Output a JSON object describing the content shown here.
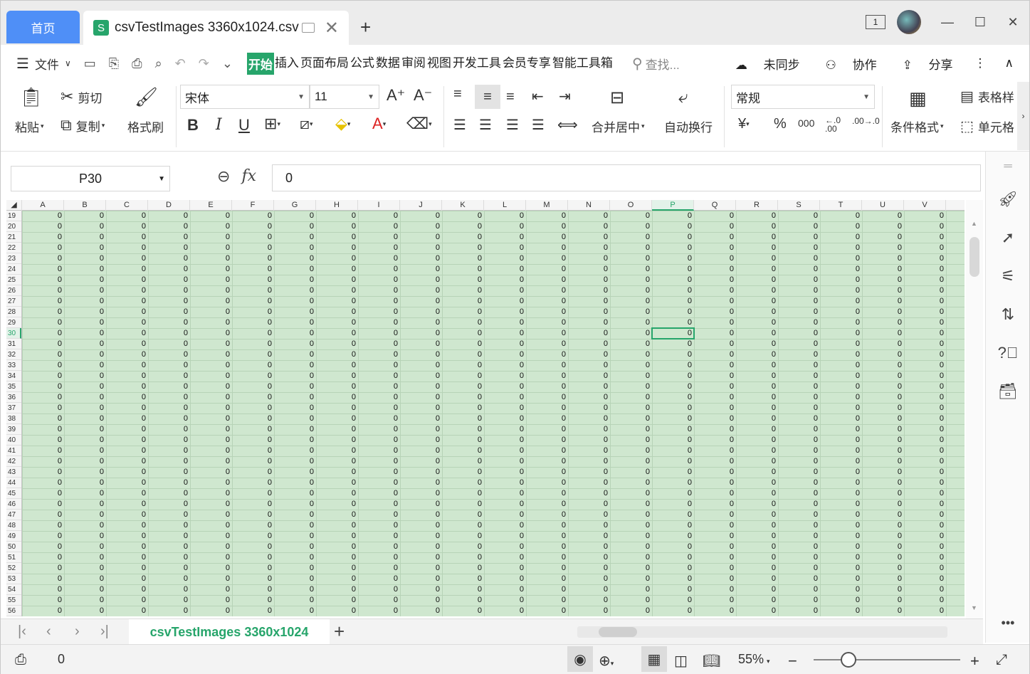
{
  "tabs": {
    "home": "首页",
    "doc_title": "csvTestImages 3360x1024.csv",
    "doc_icon": "S"
  },
  "window": {
    "badge": "1"
  },
  "menu": {
    "file": "文件",
    "ribbon_tabs": [
      "开始",
      "插入",
      "页面布局",
      "公式",
      "数据",
      "审阅",
      "视图",
      "开发工具",
      "会员专享",
      "智能工具箱"
    ],
    "active_tab": "开始",
    "search": "查找...",
    "sync": "未同步",
    "collab": "协作",
    "share": "分享"
  },
  "ribbon": {
    "paste": "粘贴",
    "cut": "剪切",
    "copy": "复制",
    "format_painter": "格式刷",
    "font_name": "宋体",
    "font_size": "11",
    "merge_center": "合并居中",
    "wrap_text": "自动换行",
    "number_format": "常规",
    "conditional_format": "条件格式",
    "table_style": "表格样",
    "cell_style": "单元格"
  },
  "formula_bar": {
    "name_box": "P30",
    "value": "0"
  },
  "grid": {
    "columns": [
      "A",
      "B",
      "C",
      "D",
      "E",
      "F",
      "G",
      "H",
      "I",
      "J",
      "K",
      "L",
      "M",
      "N",
      "O",
      "P",
      "Q",
      "R",
      "S",
      "T",
      "U",
      "V"
    ],
    "rows": [
      "19",
      "20",
      "21",
      "22",
      "23",
      "24",
      "25",
      "26",
      "27",
      "28",
      "29",
      "30",
      "31",
      "32",
      "33",
      "34",
      "35",
      "36",
      "37",
      "38",
      "39",
      "40",
      "41",
      "42",
      "43",
      "44",
      "45",
      "46",
      "47",
      "48",
      "49",
      "50",
      "51",
      "52",
      "53",
      "54",
      "55",
      "56"
    ],
    "selected_column": "P",
    "selected_row": "30",
    "cell_value": "0"
  },
  "sheet": {
    "name": "csvTestImages 3360x1024"
  },
  "status": {
    "cell_value": "0",
    "zoom": "55%"
  }
}
